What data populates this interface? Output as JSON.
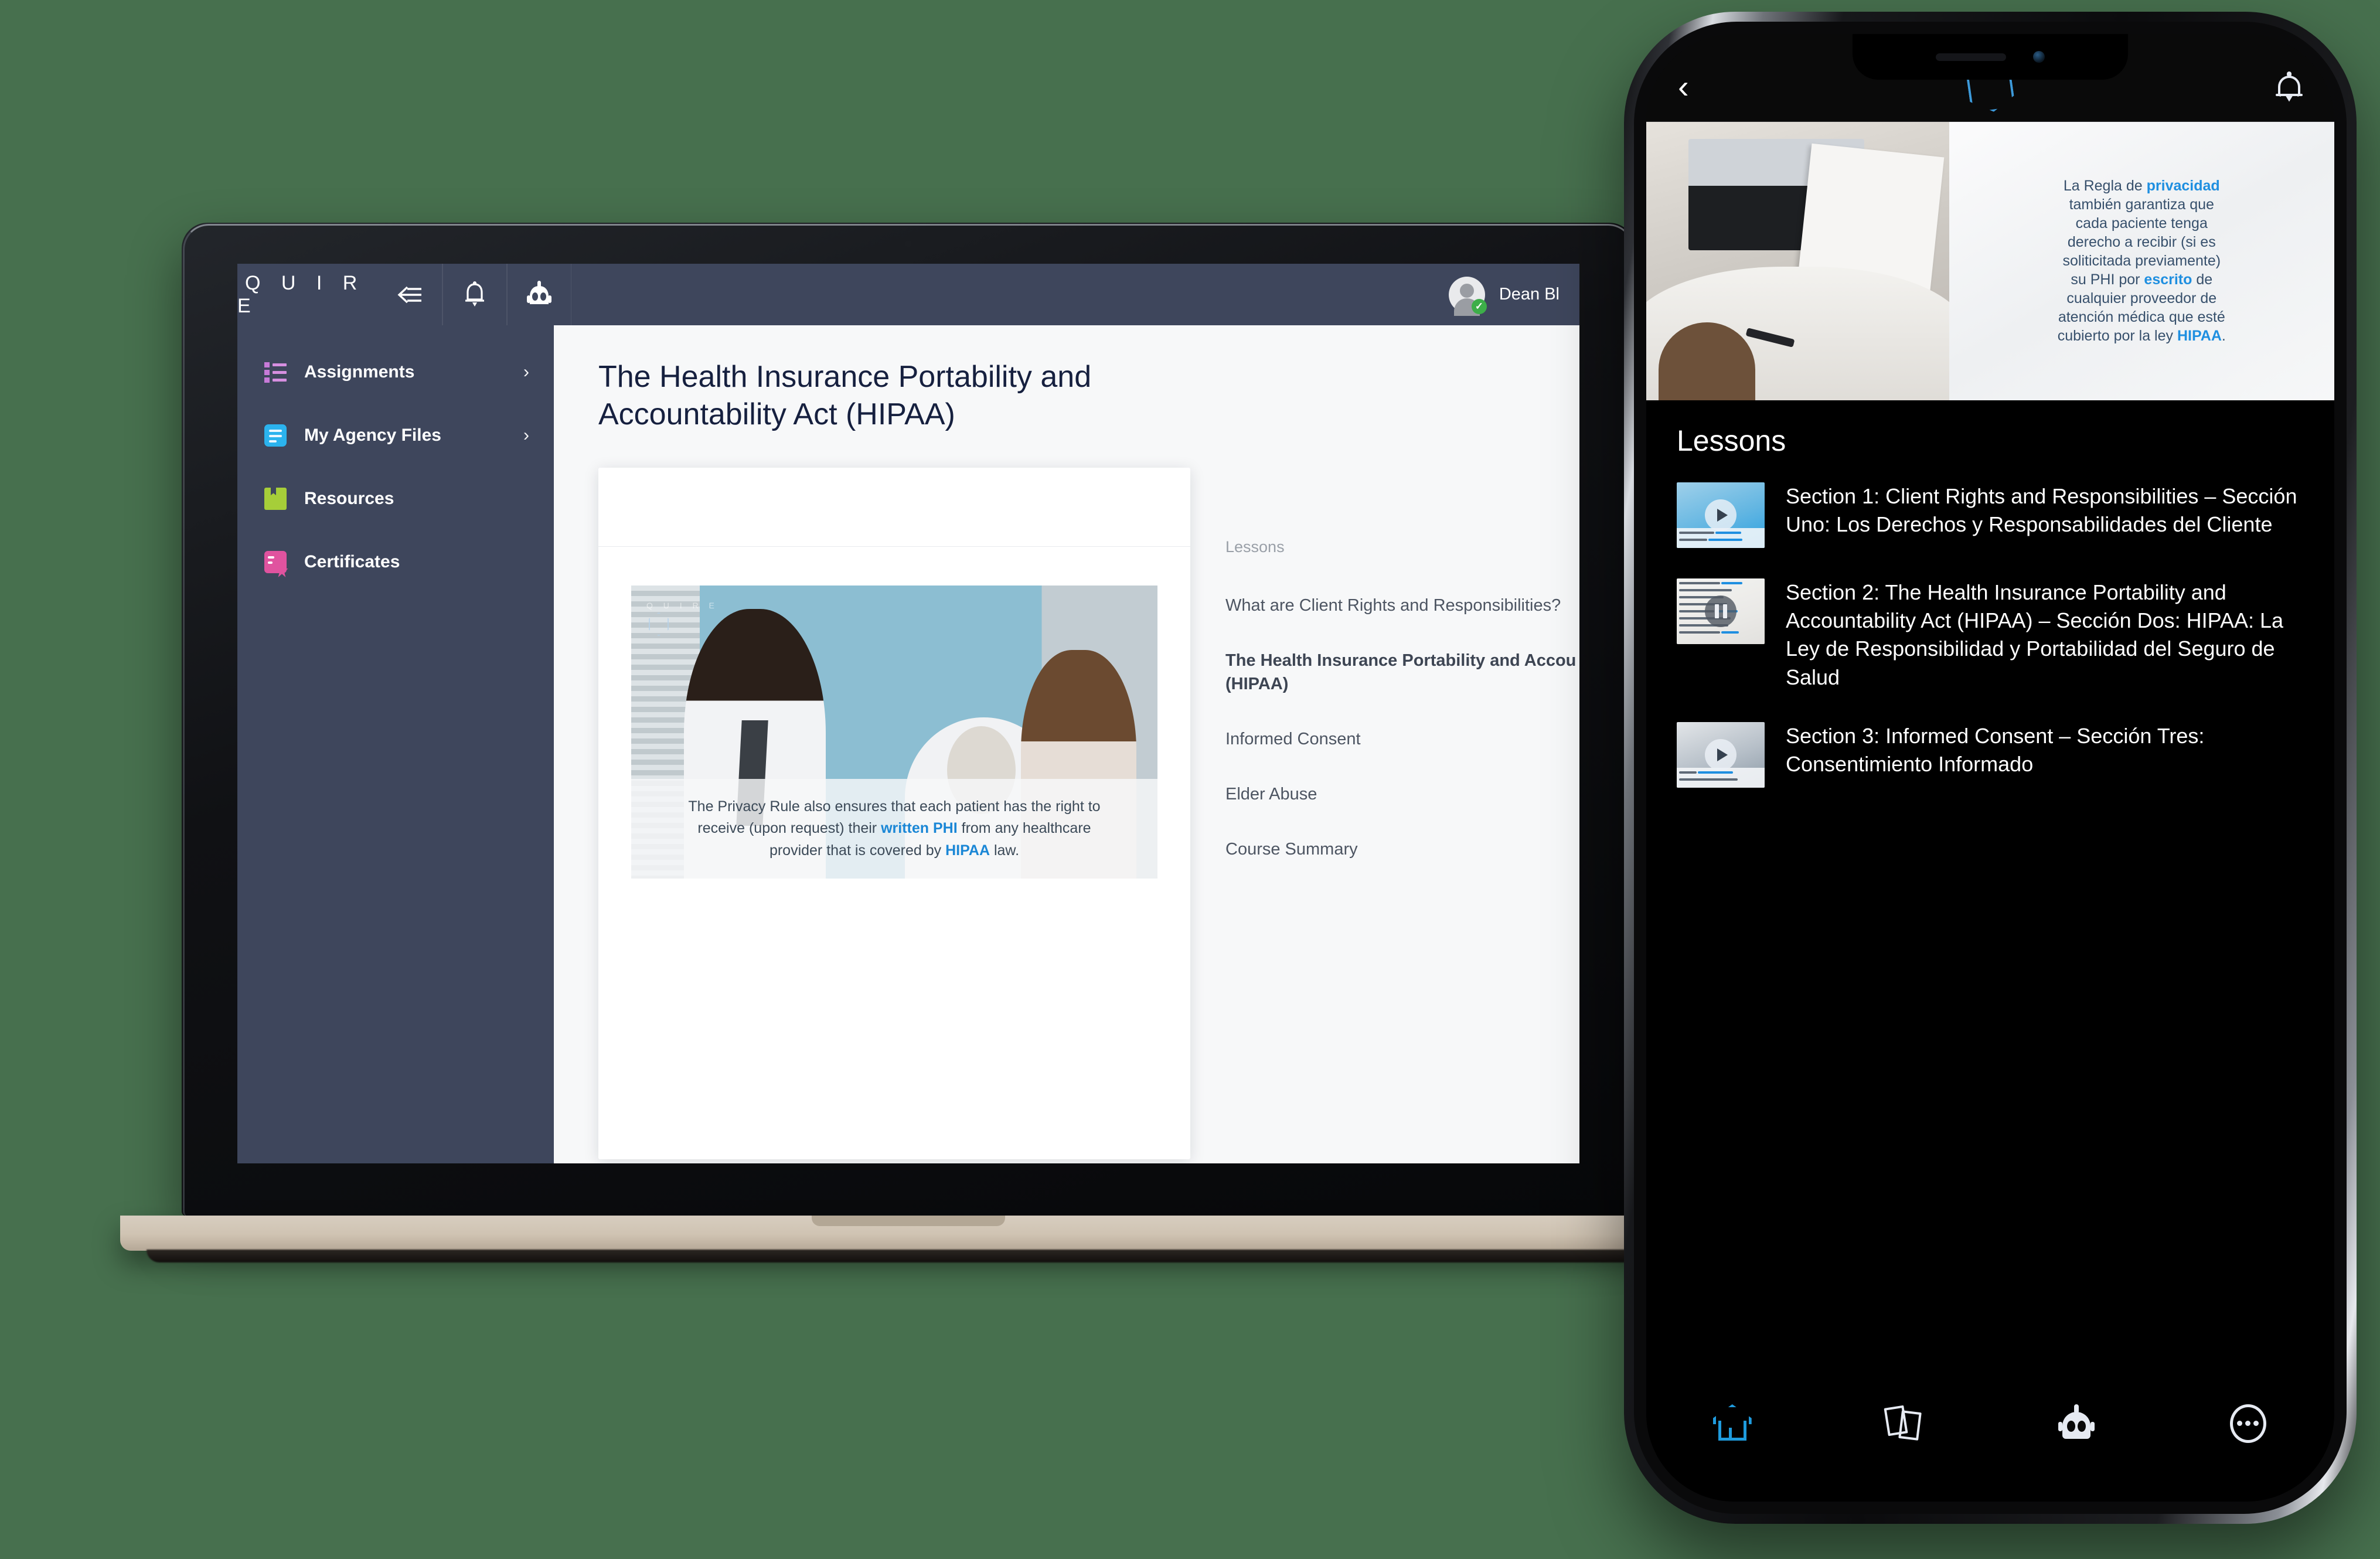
{
  "desktop": {
    "topbar": {
      "brand": "Q U I R E",
      "collapse_icon": "collapse-left-icon",
      "bell_icon": "bell-icon",
      "bot_icon": "robot-icon",
      "user_name": "Dean Bl",
      "avatar_badge": "✓"
    },
    "sidebar": {
      "items": [
        {
          "label": "Assignments",
          "icon": "list-icon",
          "color": "#c77ad8",
          "chevron": "›"
        },
        {
          "label": "My Agency Files",
          "icon": "document-icon",
          "color": "#2bb3ee",
          "chevron": "›"
        },
        {
          "label": "Resources",
          "icon": "book-icon",
          "color": "#a6ce39",
          "chevron": ""
        },
        {
          "label": "Certificates",
          "icon": "certificate-icon",
          "color": "#e0539f",
          "chevron": ""
        }
      ]
    },
    "page_title": "The Health Insurance Portability and Accountability Act (HIPAA)",
    "video": {
      "watermark": "Q U I R E",
      "caption_line1_a": "The Privacy Rule also ensures that each patient has the right to",
      "caption_line2_a": "receive (upon request) their ",
      "caption_line2_hl": "written PHI",
      "caption_line2_b": " from any healthcare",
      "caption_line3_a": "provider that is covered by ",
      "caption_line3_hl": "HIPAA",
      "caption_line3_b": " law."
    },
    "lessons": {
      "heading": "Lessons",
      "items": [
        {
          "label": "What are Client Rights and Responsibilities?",
          "active": false
        },
        {
          "label": "The Health Insurance Portability and Accou",
          "label2": "(HIPAA)",
          "active": true
        },
        {
          "label": "Informed Consent",
          "active": false
        },
        {
          "label": "Elder Abuse",
          "active": false
        },
        {
          "label": "Course Summary",
          "active": false
        }
      ]
    }
  },
  "phone": {
    "nav": {
      "back_icon": "chevron-left-icon",
      "logo_icon": "quire-hexagon-logo",
      "bell_icon": "bell-icon"
    },
    "video_caption": {
      "l1_a": "La Regla de ",
      "l1_hl": "privacidad",
      "l2": "también garantiza que",
      "l3": "cada paciente tenga",
      "l4": "derecho a recibir (si es",
      "l5": "soliticitada previamente)",
      "l6_a": "su PHI por ",
      "l6_hl": "escrito",
      "l6_b": " de",
      "l7": "cualquier proveedor de",
      "l8": "atención médica que esté",
      "l9_a": "cubierto por la ley ",
      "l9_hl": "HIPAA",
      "l9_b": "."
    },
    "lessons": {
      "heading": "Lessons",
      "items": [
        {
          "text": "Section 1: Client Rights and Responsibilities – Sección Uno: Los Derechos y Responsabilidades del Cliente",
          "state": "play"
        },
        {
          "text": "Section 2: The Health Insurance Portability and Accountability Act (HIPAA) – Sección Dos: HIPAA: La Ley de Responsibilidad y Portabilidad del Seguro de Salud",
          "state": "pause"
        },
        {
          "text": "Section 3: Informed Consent – Sección Tres: Consentimiento Informado",
          "state": "play"
        }
      ]
    },
    "tabbar": {
      "items": [
        {
          "icon": "home-icon",
          "active": true
        },
        {
          "icon": "cards-icon",
          "active": false
        },
        {
          "icon": "robot-icon",
          "active": false
        },
        {
          "icon": "more-ellipsis-icon",
          "active": false
        }
      ]
    }
  },
  "colors": {
    "background": "#47704e",
    "chrome": "#3e465c",
    "accent_blue": "#1b87d6",
    "active_tab": "#1f9bdd",
    "title": "#16203f"
  }
}
